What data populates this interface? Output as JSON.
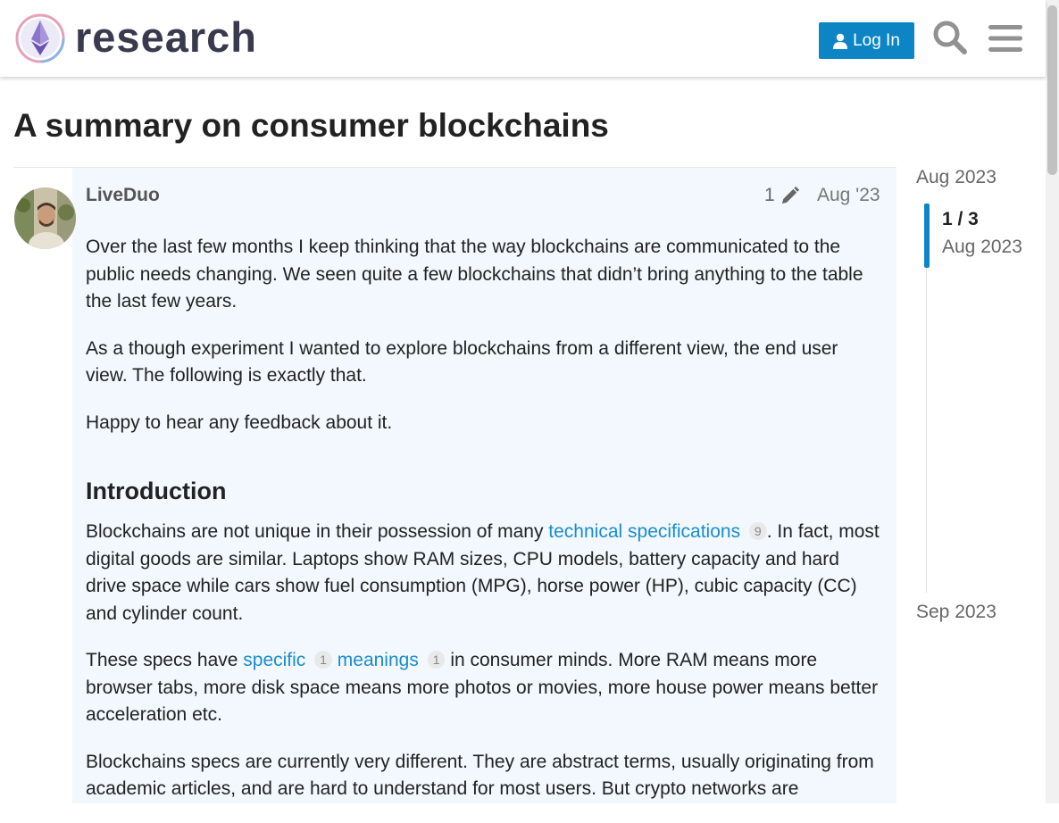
{
  "header": {
    "logo_text": "research",
    "login_label": "Log In",
    "icons": {
      "search": "search-icon",
      "menu": "hamburger-menu-icon",
      "user": "user-icon"
    },
    "accent_color": "#0d85c5"
  },
  "topic": {
    "title": "A summary on consumer blockchains"
  },
  "post": {
    "username": "LiveDuo",
    "edit_count": "1",
    "date": "Aug '23",
    "paragraphs": {
      "p1": "Over the last few months I keep thinking that the way blockchains are communicated to the public needs changing. We seen quite a few blockchains that didn’t bring anything to the table the last few years.",
      "p2": "As a though experiment I wanted to explore blockchains from a different view, the end user view. The following is exactly that.",
      "p3": "Happy to hear any feedback about it."
    },
    "heading": "Introduction",
    "intro": {
      "before_link": "Blockchains are not unique in their possession of many ",
      "link_text": "technical specifications",
      "link_count": "9",
      "after_link": ". In fact, most digital goods are similar. Laptops show RAM sizes, CPU models, battery capacity and hard drive space while cars show fuel consumption (MPG), horse power (HP), cubic capacity (CC) and cylinder count."
    },
    "specs": {
      "before": "These specs have ",
      "link1_text": "specific",
      "link1_count": "1",
      "link2_text": "meanings",
      "link2_count": "1",
      "after": " in consumer minds. More RAM means more browser tabs, more disk space means more photos or movies, more house power means better acceleration etc."
    },
    "last_paragraph": "Blockchains specs are currently very different. They are abstract terms, usually originating from academic articles, and are hard to understand for most users. But crypto networks are"
  },
  "timeline": {
    "start": "Aug 2023",
    "position": "1 / 3",
    "position_date": "Aug 2023",
    "end": "Sep 2023"
  }
}
